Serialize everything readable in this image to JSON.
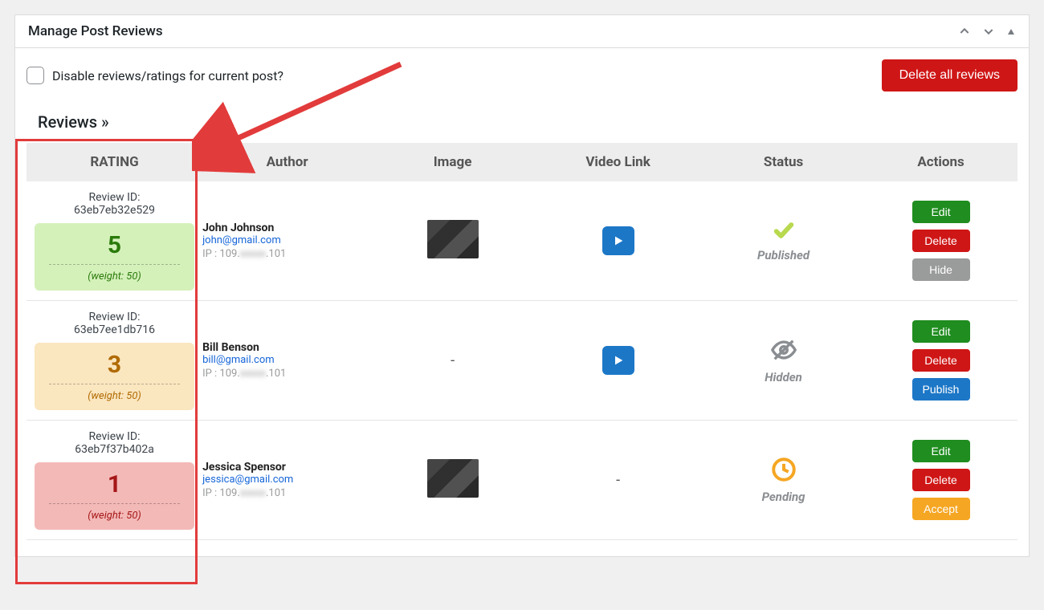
{
  "panel": {
    "title": "Manage Post Reviews"
  },
  "disable_reviews_label": "Disable reviews/ratings for current post?",
  "delete_all_label": "Delete all reviews",
  "section_heading": "Reviews »",
  "columns": {
    "rating": "RATING",
    "author": "Author",
    "image": "Image",
    "video": "Video Link",
    "status": "Status",
    "actions": "Actions"
  },
  "review_id_prefix": "Review ID:",
  "weight_prefix": "(weight: ",
  "weight_suffix": ")",
  "ip_prefix": "IP : ",
  "actions": {
    "edit": "Edit",
    "delete": "Delete",
    "hide": "Hide",
    "publish": "Publish",
    "accept": "Accept"
  },
  "rows": [
    {
      "review_id": "63eb7eb32e529",
      "rating": "5",
      "weight": "50",
      "rating_tone": "green",
      "author_name": "John Johnson",
      "author_email": "john@gmail.com",
      "ip_a": "109.",
      "ip_b": "xxxxx",
      "ip_c": ".101",
      "has_image": true,
      "has_video": true,
      "status": "Published",
      "status_kind": "published",
      "third_btn": "hide"
    },
    {
      "review_id": "63eb7ee1db716",
      "rating": "3",
      "weight": "50",
      "rating_tone": "yellow",
      "author_name": "Bill Benson",
      "author_email": "bill@gmail.com",
      "ip_a": "109.",
      "ip_b": "xxxxx",
      "ip_c": ".101",
      "has_image": false,
      "has_video": true,
      "status": "Hidden",
      "status_kind": "hidden",
      "third_btn": "publish"
    },
    {
      "review_id": "63eb7f37b402a",
      "rating": "1",
      "weight": "50",
      "rating_tone": "red",
      "author_name": "Jessica Spensor",
      "author_email": "jessica@gmail.com",
      "ip_a": "109.",
      "ip_b": "xxxxx",
      "ip_c": ".101",
      "has_image": true,
      "has_video": false,
      "status": "Pending",
      "status_kind": "pending",
      "third_btn": "accept"
    }
  ]
}
